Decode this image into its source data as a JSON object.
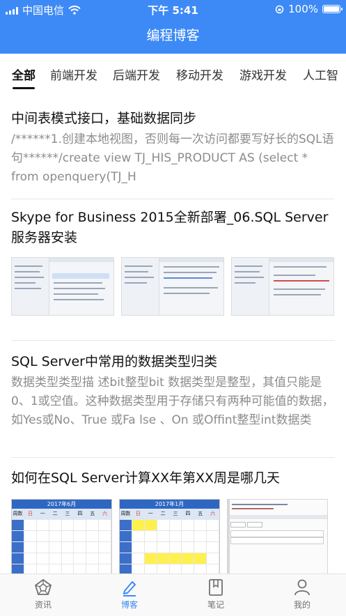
{
  "status_bar": {
    "carrier": "中国电信",
    "time": "下午 5:41",
    "battery_text": "100%",
    "battery_level": 1.0
  },
  "nav": {
    "title": "编程博客"
  },
  "tabs": [
    {
      "label": "全部",
      "active": true
    },
    {
      "label": "前端开发",
      "active": false
    },
    {
      "label": "后端开发",
      "active": false
    },
    {
      "label": "移动开发",
      "active": false
    },
    {
      "label": "游戏开发",
      "active": false
    },
    {
      "label": "人工智",
      "active": false
    }
  ],
  "articles": [
    {
      "title": "中间表模式接口，基础数据同步",
      "summary": "/******1.创建本地视图，否则每一次访问都要写好长的SQL语句******/create view TJ_HIS_PRODUCT AS (select * from openquery(TJ_H"
    },
    {
      "title": "Skype for Business 2015全新部署_06.SQL Server服务器安装"
    },
    {
      "title": "SQL Server中常用的数据类型归类",
      "summary": "数据类型类型描 述bit整型bit 数据类型是整型，其值只能是0、1或空值。这种数据类型用于存储只有两种可能值的数据，如Yes或No、True 或Fa lse 、On 或Offint整型int数据类"
    },
    {
      "title": "如何在SQL Server计算XX年第XX周是哪几天"
    }
  ],
  "calendars": [
    {
      "header": "2017年6月",
      "weekdays": [
        "周数",
        "日",
        "一",
        "二",
        "三",
        "四",
        "五",
        "六"
      ]
    },
    {
      "header": "2017年1月",
      "weekdays": [
        "周数",
        "日",
        "一",
        "二",
        "三",
        "四",
        "五",
        "六"
      ]
    }
  ],
  "bottom_tabs": [
    {
      "label": "资讯",
      "icon": "pentagon-icon",
      "active": false
    },
    {
      "label": "博客",
      "icon": "pen-icon",
      "active": true
    },
    {
      "label": "笔记",
      "icon": "bookmark-icon",
      "active": false
    },
    {
      "label": "我的",
      "icon": "person-icon",
      "active": false
    }
  ],
  "colors": {
    "brand": "#3d8af7",
    "summary_text": "#8c8c8c"
  }
}
